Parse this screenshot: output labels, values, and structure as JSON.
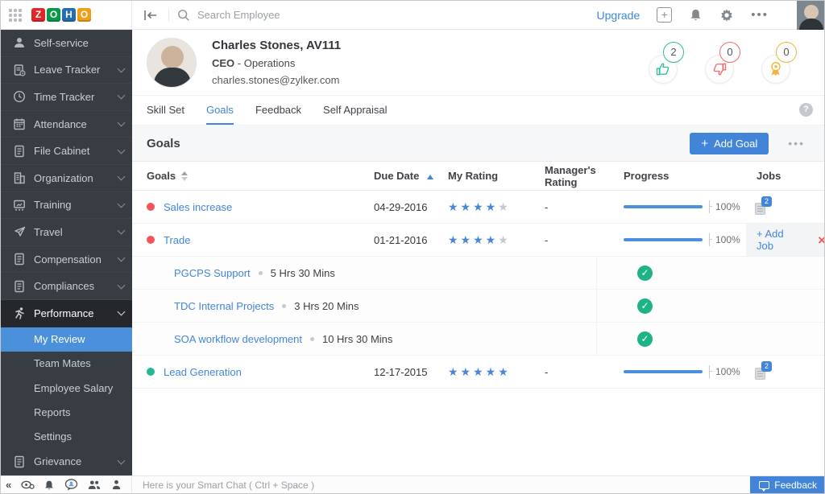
{
  "topbar": {
    "logo": {
      "letters": [
        "Z",
        "O",
        "H",
        "O"
      ],
      "colors": [
        "#e42527",
        "#089949",
        "#226db4",
        "#f0a016"
      ]
    },
    "search": {
      "placeholder": "Search Employee"
    },
    "upgrade_label": "Upgrade"
  },
  "sidebar": {
    "items": [
      {
        "label": "Self-service",
        "icon": "user-icon",
        "chevron": false
      },
      {
        "label": "Leave Tracker",
        "icon": "leave-icon",
        "chevron": true
      },
      {
        "label": "Time Tracker",
        "icon": "clock-icon",
        "chevron": true
      },
      {
        "label": "Attendance",
        "icon": "calendar-icon",
        "chevron": true
      },
      {
        "label": "File Cabinet",
        "icon": "file-icon",
        "chevron": true
      },
      {
        "label": "Organization",
        "icon": "building-icon",
        "chevron": true
      },
      {
        "label": "Training",
        "icon": "training-icon",
        "chevron": true
      },
      {
        "label": "Travel",
        "icon": "plane-icon",
        "chevron": true
      },
      {
        "label": "Compensation",
        "icon": "doc-icon",
        "chevron": true
      },
      {
        "label": "Compliances",
        "icon": "doc-icon",
        "chevron": true
      },
      {
        "label": "Performance",
        "icon": "runner-icon",
        "chevron": true,
        "expanded": true
      },
      {
        "label": "Grievance",
        "icon": "doc-icon",
        "chevron": true
      }
    ],
    "performance_children": [
      {
        "label": "My Review",
        "selected": true
      },
      {
        "label": "Team Mates"
      },
      {
        "label": "Employee Salary"
      },
      {
        "label": "Reports"
      },
      {
        "label": "Settings"
      }
    ]
  },
  "employee": {
    "name": "Charles Stones, AV111",
    "role_bold": "CEO",
    "role_rest": " - Operations",
    "email": "charles.stones@zylker.com",
    "badges": [
      {
        "type": "thumbs-up",
        "count": "2",
        "color": "#2db9a1"
      },
      {
        "type": "thumbs-down",
        "count": "0",
        "color": "#ee6a6e"
      },
      {
        "type": "award",
        "count": "0",
        "color": "#f0b43c"
      }
    ]
  },
  "tabs": [
    {
      "label": "Skill Set"
    },
    {
      "label": "Goals",
      "active": true
    },
    {
      "label": "Feedback"
    },
    {
      "label": "Self Appraisal"
    }
  ],
  "section": {
    "title": "Goals",
    "add_button": "Add Goal",
    "plus": "+"
  },
  "table": {
    "headers": {
      "goals": "Goals",
      "due": "Due Date",
      "my": "My Rating",
      "mgr": "Manager's Rating",
      "progress": "Progress",
      "jobs": "Jobs"
    },
    "rows": [
      {
        "name": "Sales increase",
        "dot_color": "#f25658",
        "due": "04-29-2016",
        "stars_filled": "★★★★",
        "stars_empty": "★",
        "mgr": "-",
        "progress": "100%",
        "jobs_count": "2"
      },
      {
        "name": "Trade",
        "dot_color": "#f25658",
        "due": "01-21-2016",
        "stars_filled": "★★★★",
        "stars_empty": "★",
        "mgr": "-",
        "progress": "100%",
        "add_job_label": "+ Add Job",
        "close_label": "×",
        "jobs": [
          {
            "name": "PGCPS Support",
            "duration": "5 Hrs 30 Mins",
            "done": "✓"
          },
          {
            "name": "TDC Internal Projects",
            "duration": "3 Hrs 20 Mins",
            "done": "✓"
          },
          {
            "name": "SOA workflow development",
            "duration": "10 Hrs 30 Mins",
            "done": "✓"
          }
        ]
      },
      {
        "name": "Lead Generation",
        "dot_color": "#23b794",
        "due": "12-17-2015",
        "stars_filled": "★★★★★",
        "stars_empty": "",
        "mgr": "-",
        "progress": "100%",
        "jobs_count": "2"
      }
    ]
  },
  "footer": {
    "chat_placeholder": "Here is your Smart Chat ( Ctrl + Space )",
    "feedback_label": "Feedback"
  },
  "help_label": "?"
}
